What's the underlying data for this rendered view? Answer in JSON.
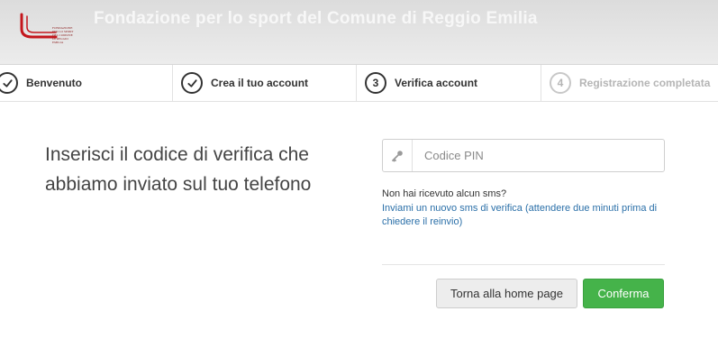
{
  "header": {
    "title": "Fondazione per lo sport del Comune di Reggio Emilia",
    "logo_text": "FONDAZIONE PER LO SPORT DEL COMUNE DI REGGIO EMILIA",
    "logo_color": "#c4161c"
  },
  "steps": [
    {
      "label": "Benvenuto",
      "state": "done",
      "icon": "check-icon"
    },
    {
      "label": "Crea il tuo account",
      "state": "done",
      "icon": "check-icon"
    },
    {
      "label": "Verifica account",
      "state": "current",
      "number": "3"
    },
    {
      "label": "Registrazione completata",
      "state": "upcoming",
      "number": "4"
    }
  ],
  "main": {
    "instruction": "Inserisci il codice di verifica che abbiamo inviato sul tuo telefono",
    "pin": {
      "placeholder": "Codice PIN",
      "value": "",
      "icon": "key-icon"
    },
    "no_sms_text": "Non hai ricevuto alcun sms?",
    "resend_link": "Inviami un nuovo sms di verifica (attendere due minuti prima di chiedere il reinvio)"
  },
  "actions": {
    "home_label": "Torna alla home page",
    "confirm_label": "Conferma"
  },
  "colors": {
    "accent_green": "#45b34a",
    "link_blue": "#2a6fa8",
    "inactive_gray": "#b5b5b5"
  }
}
